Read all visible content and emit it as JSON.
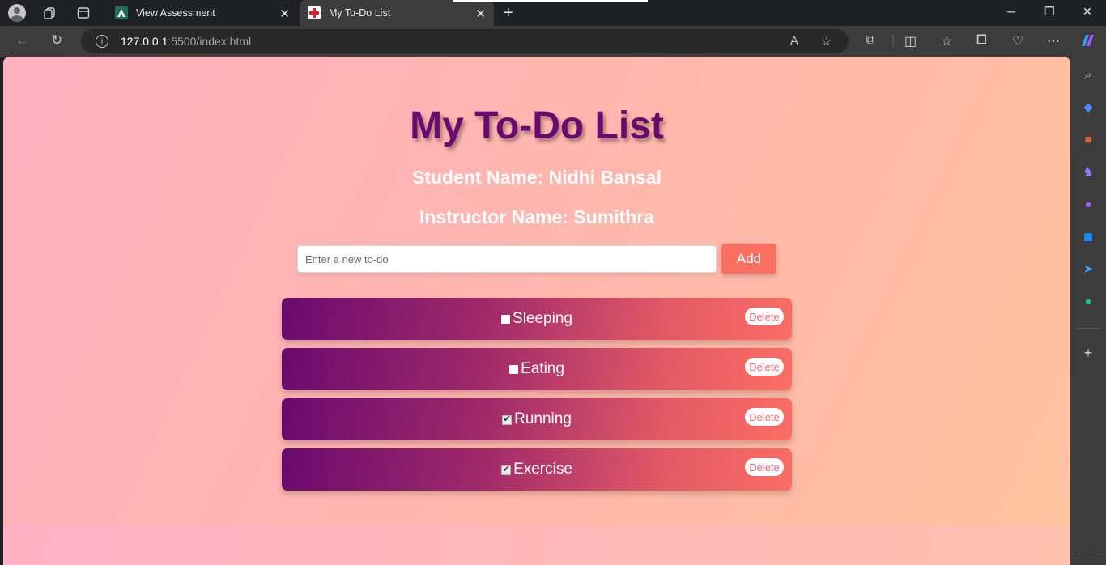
{
  "browser": {
    "tabs": [
      {
        "title": "View Assessment",
        "active": false
      },
      {
        "title": "My To-Do List",
        "active": true
      }
    ],
    "address": {
      "host": "127.0.0.1",
      "path": ":5500/index.html"
    }
  },
  "page": {
    "title": "My To-Do List",
    "student_line": "Student Name: Nidhi Bansal",
    "instructor_line": "Instructor Name: Sumithra",
    "input": {
      "placeholder": "Enter a new to-do",
      "value": ""
    },
    "add_label": "Add",
    "todos": [
      {
        "text": "Sleeping",
        "done": false,
        "delete_label": "Delete"
      },
      {
        "text": "Eating",
        "done": false,
        "delete_label": "Delete"
      },
      {
        "text": "Running",
        "done": true,
        "delete_label": "Delete"
      },
      {
        "text": "Exercise",
        "done": true,
        "delete_label": "Delete"
      }
    ]
  },
  "colors": {
    "title": "#6a0a6e",
    "add_button": "#fa6f62",
    "item_gradient_start": "#6a0a6e",
    "item_gradient_end": "#fb6e64",
    "delete_text": "#f06a78"
  },
  "icons": {
    "checked": "✔",
    "unchecked": ""
  }
}
